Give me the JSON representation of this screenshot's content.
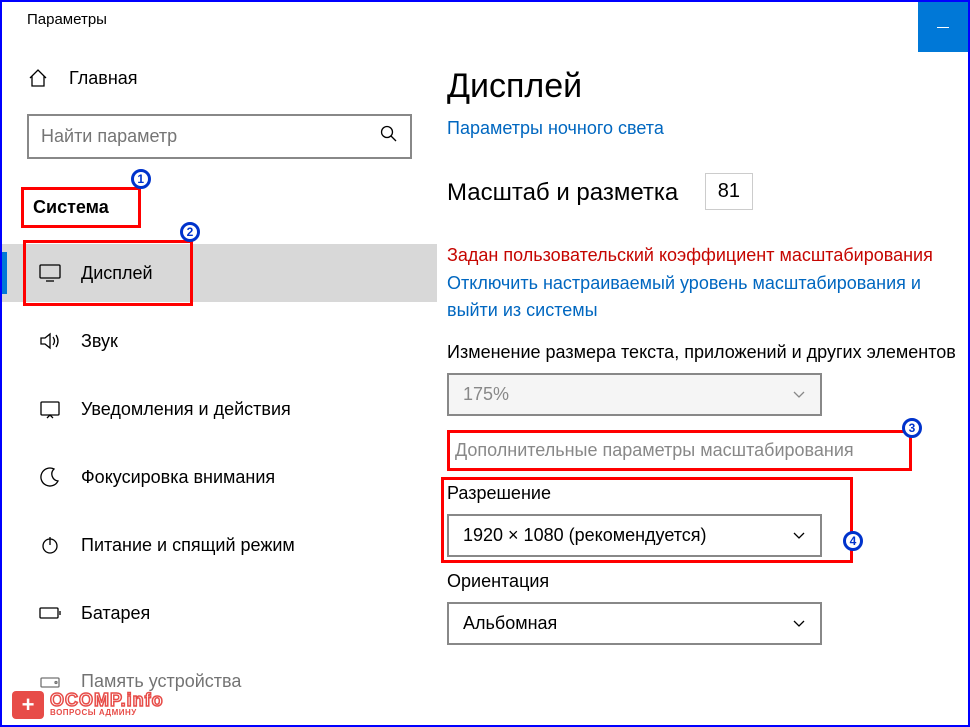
{
  "window": {
    "title": "Параметры"
  },
  "sidebar": {
    "home": "Главная",
    "search_placeholder": "Найти параметр",
    "group": "Система",
    "items": [
      {
        "label": "Дисплей"
      },
      {
        "label": "Звук"
      },
      {
        "label": "Уведомления и действия"
      },
      {
        "label": "Фокусировка внимания"
      },
      {
        "label": "Питание и спящий режим"
      },
      {
        "label": "Батарея"
      },
      {
        "label": "Память устройства"
      }
    ]
  },
  "main": {
    "title": "Дисплей",
    "night_light_link": "Параметры ночного света",
    "scale_heading": "Масштаб и разметка",
    "scale_value": "81",
    "warning": "Задан пользовательский коэффициент масштабирования",
    "disable_link": "Отключить настраиваемый уровень масштабирования и выйти из системы",
    "scale_label": "Изменение размера текста, приложений и других элементов",
    "scale_select": "175%",
    "advanced_scaling": "Дополнительные параметры масштабирования",
    "resolution_label": "Разрешение",
    "resolution_value": "1920 × 1080 (рекомендуется)",
    "orientation_label": "Ориентация",
    "orientation_value": "Альбомная"
  },
  "badges": {
    "b1": "1",
    "b2": "2",
    "b3": "3",
    "b4": "4"
  },
  "watermark": {
    "main": "OCOMP.info",
    "sub": "ВОПРОСЫ АДМИНУ"
  }
}
